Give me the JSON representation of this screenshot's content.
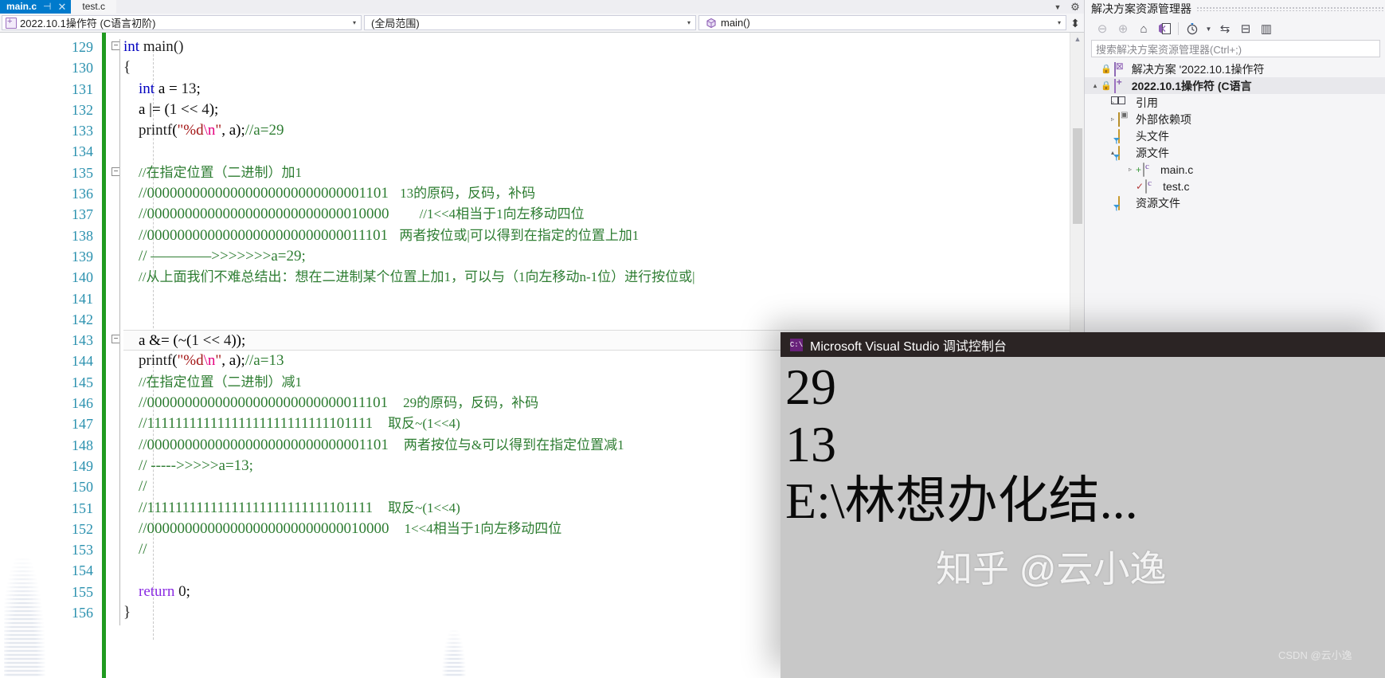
{
  "tabs": [
    {
      "label": "main.c",
      "active": true,
      "pin": "⊣",
      "close": "✕"
    },
    {
      "label": "test.c",
      "active": false
    }
  ],
  "nav_bar": {
    "project": "2022.10.1操作符 (C语言初阶)",
    "scope": "(全局范围)",
    "member": "main()",
    "caret": "▾"
  },
  "code": {
    "first_line_number": 129,
    "lines": [
      {
        "n": 129,
        "html": "<span class=\"kw\">int</span> <span class=\"fn\">main</span><span class=\"var\">()</span>"
      },
      {
        "n": 130,
        "html": "<span class=\"var\">{</span>"
      },
      {
        "n": 131,
        "html": "    <span class=\"kw\">int</span> a = <span class=\"num\">13</span>;"
      },
      {
        "n": 132,
        "html": "    a |= (<span class=\"num\">1</span> &lt;&lt; <span class=\"num\">4</span>);"
      },
      {
        "n": 133,
        "html": "    <span class=\"fn\">printf</span>(<span class=\"str\">\"%d</span><span class=\"esc\">\\n</span><span class=\"str\">\"</span>, a);<span class=\"cmt\">//a=29</span>"
      },
      {
        "n": 134,
        "html": ""
      },
      {
        "n": 135,
        "html": "    <span class=\"cmt cmt-cn\">//在指定位置（二进制）加1</span>"
      },
      {
        "n": 136,
        "html": "    <span class=\"cmt\">//00000000000000000000000000001101</span>   <span class=\"cmt cmt-cn\">13的原码，反码，补码</span>"
      },
      {
        "n": 137,
        "html": "    <span class=\"cmt\">//00000000000000000000000000010000</span>        <span class=\"cmt cmt-cn\">//1&lt;&lt;4相当于1向左移动四位</span>"
      },
      {
        "n": 138,
        "html": "    <span class=\"cmt\">//00000000000000000000000000011101</span>   <span class=\"cmt cmt-cn\">两者按位或|可以得到在指定的位置上加1</span>"
      },
      {
        "n": 139,
        "html": "    <span class=\"cmt\">// ————&gt;&gt;&gt;&gt;&gt;&gt;&gt;a=29;</span>"
      },
      {
        "n": 140,
        "html": "    <span class=\"cmt cmt-cn\">//从上面我们不难总结出：想在二进制某个位置上加1，可以与（1向左移动n-1位）进行按位或|</span>"
      },
      {
        "n": 141,
        "html": ""
      },
      {
        "n": 142,
        "html": ""
      },
      {
        "n": 143,
        "html": "    a &amp;= (~(<span class=\"num\">1</span> &lt;&lt; <span class=\"num\">4</span>));",
        "current": true
      },
      {
        "n": 144,
        "html": "    <span class=\"fn\">printf</span>(<span class=\"str\">\"%d</span><span class=\"esc\">\\n</span><span class=\"str\">\"</span>, a);<span class=\"cmt\">//a=13</span>"
      },
      {
        "n": 145,
        "html": "    <span class=\"cmt cmt-cn\">//在指定位置（二进制）减1</span>"
      },
      {
        "n": 146,
        "html": "    <span class=\"cmt\">//00000000000000000000000000011101</span>    <span class=\"cmt cmt-cn\">29的原码，反码，补码</span>"
      },
      {
        "n": 147,
        "html": "    <span class=\"cmt\">//11111111111111111111111111101111</span>    <span class=\"cmt cmt-cn\">取反~(1&lt;&lt;4)</span>"
      },
      {
        "n": 148,
        "html": "    <span class=\"cmt\">//00000000000000000000000000001101</span>    <span class=\"cmt cmt-cn\">两者按位与&amp;可以得到在指定位置减1</span>"
      },
      {
        "n": 149,
        "html": "    <span class=\"cmt\">// -----&gt;&gt;&gt;&gt;&gt;a=13;</span>"
      },
      {
        "n": 150,
        "html": "    <span class=\"cmt\">//</span>"
      },
      {
        "n": 151,
        "html": "    <span class=\"cmt\">//11111111111111111111111111101111</span>    <span class=\"cmt cmt-cn\">取反~(1&lt;&lt;4)</span>"
      },
      {
        "n": 152,
        "html": "    <span class=\"cmt\">//00000000000000000000000000010000</span>    <span class=\"cmt cmt-cn\">1&lt;&lt;4相当于1向左移动四位</span>"
      },
      {
        "n": 153,
        "html": "    <span class=\"cmt\">//</span>"
      },
      {
        "n": 154,
        "html": ""
      },
      {
        "n": 155,
        "html": "    <span class=\"kw2\">return</span> <span class=\"num\">0</span>;"
      },
      {
        "n": 156,
        "html": "<span class=\"var\">}</span>"
      }
    ]
  },
  "solution_explorer": {
    "title": "解决方案资源管理器",
    "toolbar_icons": [
      "back-arrow-icon",
      "forward-arrow-icon",
      "home-icon",
      "sync-with-active-document-icon",
      "pending-changes-icon",
      "chevron-down-icon",
      "refresh-icon",
      "collapse-all-icon",
      "properties-icon"
    ],
    "search_placeholder": "搜索解决方案资源管理器(Ctrl+;)",
    "tree": [
      {
        "label": "解决方案 '2022.10.1操作符",
        "indent": 0,
        "icon": "solution-icon",
        "expander": "",
        "lock": true,
        "bold": false
      },
      {
        "label": "2022.10.1操作符  (C语言",
        "indent": 1,
        "icon": "project-icon",
        "expander": "▴",
        "lock": true,
        "bold": true,
        "selected": true
      },
      {
        "label": "引用",
        "indent": 2,
        "icon": "references-icon",
        "expander": "▹",
        "bold": false
      },
      {
        "label": "外部依赖项",
        "indent": 2,
        "icon": "external-dependencies-icon",
        "expander": "▹",
        "bold": false
      },
      {
        "label": "头文件",
        "indent": 2,
        "icon": "filter-folder-icon",
        "expander": "",
        "bold": false
      },
      {
        "label": "源文件",
        "indent": 2,
        "icon": "filter-folder-icon",
        "expander": "▴",
        "bold": false
      },
      {
        "label": "main.c",
        "indent": 3,
        "icon": "c-file-icon",
        "expander": "▹",
        "marker": "+",
        "bold": false
      },
      {
        "label": "test.c",
        "indent": 3,
        "icon": "c-file-icon",
        "expander": "",
        "marker": "✓",
        "bold": false
      },
      {
        "label": "资源文件",
        "indent": 2,
        "icon": "filter-folder-icon",
        "expander": "",
        "bold": false
      }
    ]
  },
  "console": {
    "title": "Microsoft Visual Studio 调试控制台",
    "icon_label": "C:\\",
    "lines": [
      "29",
      "13",
      "",
      "E:\\林想办化结..."
    ]
  },
  "watermarks": {
    "zhihu": "知乎 @云小逸",
    "csdn": "CSDN @云小逸"
  },
  "colors": {
    "tab_active_bg": "#007acc",
    "comment_green": "#2e7d32",
    "keyword_blue": "#0000c0",
    "linenum_blue": "#2b91af",
    "string_red": "#a31515",
    "changebar_green": "#1f9a1f",
    "console_bg": "#c8c8c8",
    "console_title_bg": "#2b2424"
  }
}
